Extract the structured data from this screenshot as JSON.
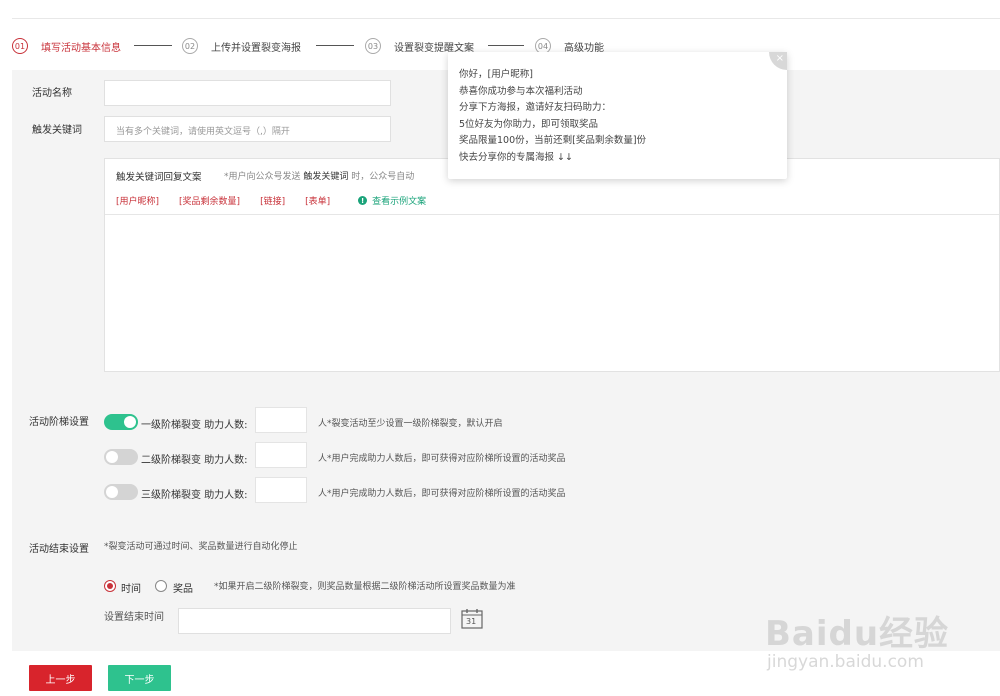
{
  "steps": [
    {
      "num": "01",
      "label": "填写活动基本信息"
    },
    {
      "num": "02",
      "label": "上传并设置裂变海报"
    },
    {
      "num": "03",
      "label": "设置裂变提醒文案"
    },
    {
      "num": "04",
      "label": "高级功能"
    }
  ],
  "form": {
    "activity_name_label": "活动名称",
    "activity_name_value": "",
    "keyword_label": "触发关键词",
    "keyword_placeholder": "当有多个关键词，请使用英文逗号（,）隔开",
    "reply": {
      "title": "触发关键词回复文案",
      "note_prefix": "*用户向公众号发送",
      "note_highlight": "触发关键词",
      "note_suffix": "时，公众号自动",
      "tags": [
        "[用户昵称]",
        "[奖品剩余数量]",
        "[链接]",
        "[表单]"
      ],
      "example_label": "查看示例文案",
      "example_icon": "info-icon",
      "content": ""
    },
    "tiers_label": "活动阶梯设置",
    "tiers": [
      {
        "name": "一级阶梯裂变",
        "helpers_label": "助力人数:",
        "value": "",
        "unit_note": "人*裂变活动至少设置一级阶梯裂变，默认开启",
        "enabled": true
      },
      {
        "name": "二级阶梯裂变",
        "helpers_label": "助力人数:",
        "value": "",
        "unit_note": "人*用户完成助力人数后，即可获得对应阶梯所设置的活动奖品",
        "enabled": false
      },
      {
        "name": "三级阶梯裂变",
        "helpers_label": "助力人数:",
        "value": "",
        "unit_note": "人*用户完成助力人数后，即可获得对应阶梯所设置的活动奖品",
        "enabled": false
      }
    ],
    "end_label": "活动结束设置",
    "end_note": "*裂变活动可通过时间、奖品数量进行自动化停止",
    "end_options": [
      {
        "label": "时间",
        "checked": true
      },
      {
        "label": "奖品",
        "checked": false
      }
    ],
    "end_option_note": "*如果开启二级阶梯裂变，则奖品数量根据二级阶梯活动所设置奖品数量为准",
    "end_time_label": "设置结束时间",
    "end_time_value": "",
    "calendar_icon": "calendar-icon",
    "calendar_day": "31"
  },
  "buttons": {
    "prev": "上一步",
    "next": "下一步"
  },
  "popup": {
    "close_icon": "close-icon",
    "close_glyph": "×",
    "lines": [
      "你好，[用户昵称]",
      "恭喜你成功参与本次福利活动",
      "分享下方海报，邀请好友扫码助力：",
      "5位好友为你助力，即可领取奖品",
      "奖品限量100份，当前还剩[奖品剩余数量]份",
      "快去分享你的专属海报 ↓↓"
    ]
  },
  "watermark": {
    "logo": "Baidu经验",
    "url": "jingyan.baidu.com"
  },
  "colors": {
    "accent_red": "#c8323a",
    "button_red": "#d8242c",
    "accent_green": "#2ec28e",
    "panel_bg": "#f4f4f4"
  }
}
